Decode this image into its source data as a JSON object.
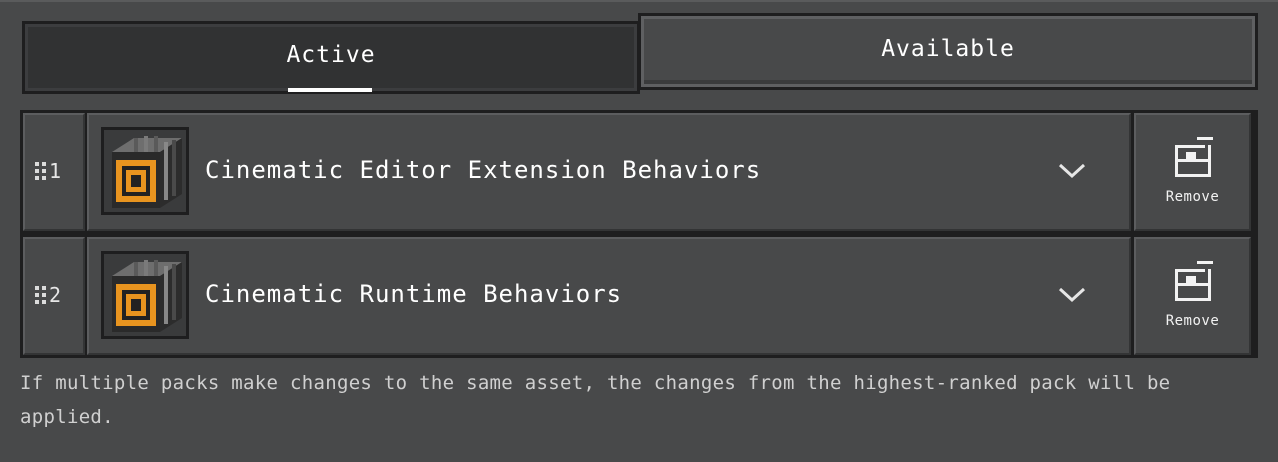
{
  "tabs": [
    {
      "label": "Active",
      "selected": true
    },
    {
      "label": "Available",
      "selected": false
    }
  ],
  "packs": [
    {
      "rank": "1",
      "name": "Cinematic Editor Extension Behaviors",
      "icon": "cinematic-pack-icon",
      "action_label": "Remove",
      "action_icon": "remove-pack-icon",
      "expand_icon": "chevron-down-icon"
    },
    {
      "rank": "2",
      "name": "Cinematic Runtime Behaviors",
      "icon": "cinematic-pack-icon",
      "action_label": "Remove",
      "action_icon": "remove-pack-icon",
      "expand_icon": "chevron-down-icon"
    }
  ],
  "footer": {
    "note": "If multiple packs make changes to the same asset, the changes from the highest-ranked pack will be applied."
  },
  "colors": {
    "background": "#48494a",
    "tab_active_bg": "#313233",
    "border_dark": "#1e1e1f",
    "pack_icon_orange": "#e8941f"
  }
}
